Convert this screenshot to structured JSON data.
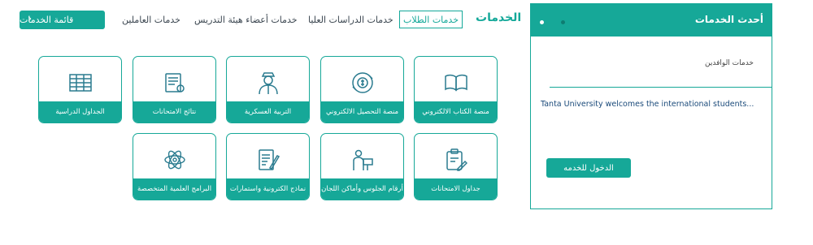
{
  "nav": {
    "menu_button": "قائمة الخدمات",
    "links": [
      "خدمات العاملين",
      "خدمات أعضاء هيئة التدريس",
      "خدمات الدراسات العليا"
    ],
    "active_tab": "خدمات الطلاب",
    "heading": "الخدمات"
  },
  "cards": [
    {
      "label": "منصة الكتاب الالكتروني",
      "icon": "open-book-icon"
    },
    {
      "label": "منصة التحصيل الالكتروني",
      "icon": "money-cycle-icon"
    },
    {
      "label": "التربية العسكرية",
      "icon": "soldier-icon"
    },
    {
      "label": "نتائج الامتحانات",
      "icon": "results-sheet-icon"
    },
    {
      "label": "الجداول الدراسية",
      "icon": "timetable-icon"
    },
    {
      "label": "جداول الامتحانات",
      "icon": "clipboard-edit-icon"
    },
    {
      "label": "أرقام الجلوس وأماكن اللجان",
      "icon": "exam-desk-icon"
    },
    {
      "label": "نماذج الكترونية واستمارات",
      "icon": "form-pen-icon"
    },
    {
      "label": "البرامج العلمية المتخصصة",
      "icon": "science-atom-icon"
    }
  ],
  "latest": {
    "title": "أحدث الخدمات",
    "item_title": "خدمات الوافدين",
    "item_desc": "Tanta University welcomes the international students...",
    "button": "الدخول للخدمه"
  },
  "colors": {
    "accent": "#16a898",
    "text": "#3b4650"
  }
}
